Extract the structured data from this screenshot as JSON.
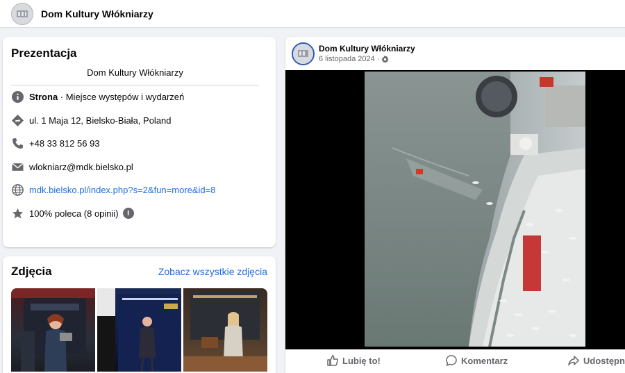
{
  "header": {
    "title": "Dom Kultury Włókniarzy"
  },
  "intro": {
    "heading": "Prezentacja",
    "bio": "Dom Kultury Włókniarzy",
    "category_label": "Strona",
    "category_rest": " · Miejsce występów i wydarzeń",
    "address": "ul. 1 Maja 12, Bielsko-Biała, Poland",
    "phone": "+48 33 812 56 93",
    "email": "wlokniarz@mdk.bielsko.pl",
    "website": "mdk.bielsko.pl/index.php?s=2&fun=more&id=8",
    "rating": "100% poleca (8 opinii)"
  },
  "photos": {
    "heading": "Zdjęcia",
    "see_all": "Zobacz wszystkie zdjęcia"
  },
  "post": {
    "author": "Dom Kultury Włókniarzy",
    "date": "6 listopada 2024 ·",
    "like_label": "Lubię to!",
    "comment_label": "Komentarz",
    "share_label": "Udostępnij"
  },
  "colors": {
    "link": "#216fdb",
    "icon": "#65676b",
    "accent_border": "#2a5db0"
  }
}
